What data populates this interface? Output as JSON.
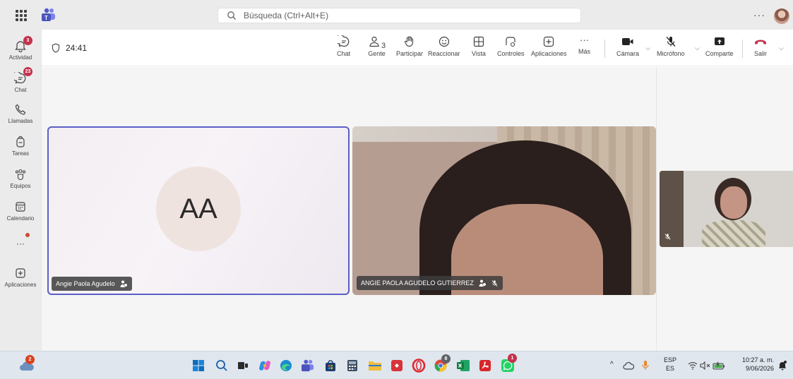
{
  "search": {
    "placeholder": "Búsqueda (Ctrl+Alt+E)"
  },
  "topbar": {
    "more": "···"
  },
  "rail": {
    "items": [
      {
        "label": "Actividad",
        "badge": "3"
      },
      {
        "label": "Chat",
        "badge": "23"
      },
      {
        "label": "Llamadas"
      },
      {
        "label": "Tareas"
      },
      {
        "label": "Equipos"
      },
      {
        "label": "Calendario"
      },
      {
        "label": "···"
      },
      {
        "label": "Aplicaciones"
      }
    ]
  },
  "meeting": {
    "timer": "24:41",
    "toolbar": {
      "chat": "Chat",
      "people": "Gente",
      "people_count": "3",
      "raise": "Participar",
      "react": "Reaccionar",
      "view": "Vista",
      "controls": "Controles",
      "apps": "Aplicaciones",
      "more": "Más",
      "camera": "Cámara",
      "mic": "Micrófono",
      "share": "Comparte",
      "leave": "Salir"
    }
  },
  "tiles": {
    "a": {
      "initials": "AA",
      "name": "Angie Paola Agudelo"
    },
    "b": {
      "name": "ANGIE PAOLA AGUDELO GUTIERREZ"
    }
  },
  "taskbar": {
    "weather_badge": "2",
    "chrome_badge": "8",
    "whatsapp_badge": "1",
    "lang_1": "ESP",
    "lang_2": "ES",
    "time": "10:27 a. m.",
    "date": "9/06/2026"
  },
  "colors": {
    "accent": "#5b5fc7",
    "badge": "#c4314b",
    "leave": "#c4314b"
  }
}
